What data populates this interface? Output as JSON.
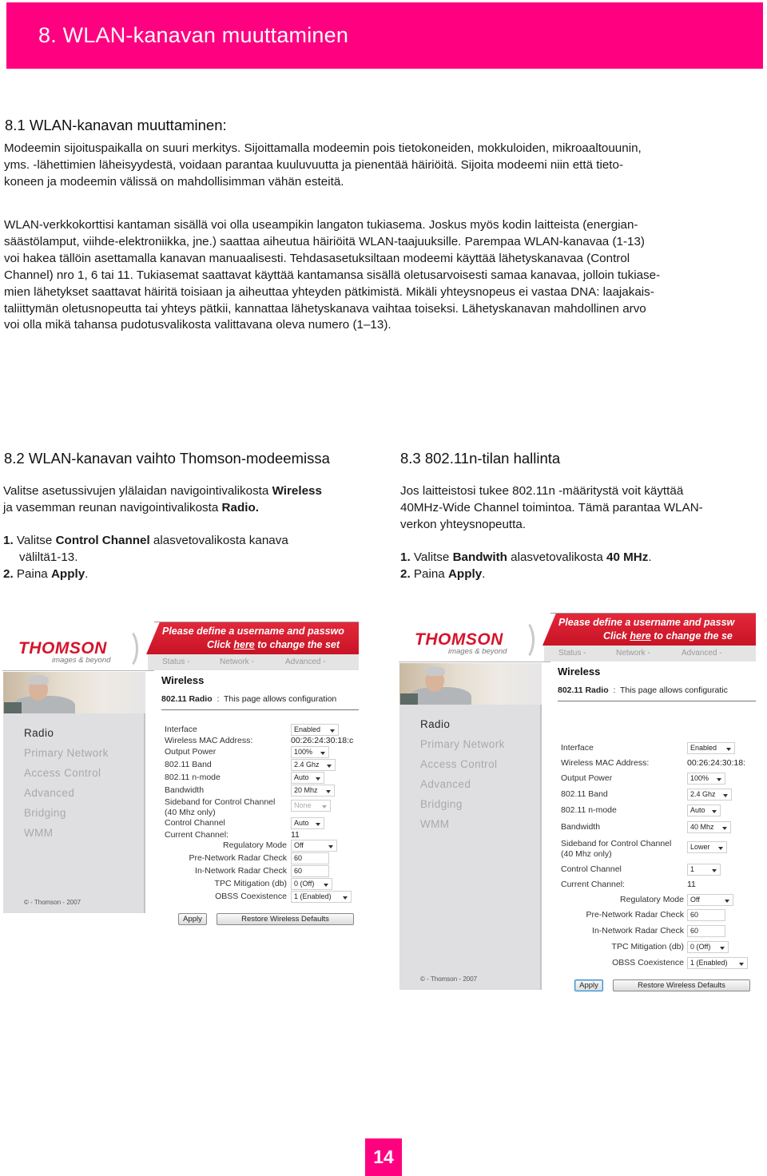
{
  "colors": {
    "accent": "#FF0080",
    "modem_red": "#D5142B"
  },
  "header": {
    "title": "8. WLAN-kanavan muuttaminen"
  },
  "section_8_1": {
    "heading": "8.1 WLAN-kanavan muuttaminen:",
    "paragraph1_lines": [
      "Modeemin sijoituspaikalla on suuri merkitys. Sijoittamalla modeemin pois tietokoneiden, mokkuloiden, mikroaaltouunin,",
      "yms. -lähettimien läheisyydestä, voidaan parantaa kuuluvuutta ja pienentää häiriöitä. Sijoita modeemi niin että tieto-",
      "koneen ja modeemin välissä on mahdollisimman vähän esteitä."
    ],
    "paragraph2_lines": [
      "WLAN-verkkokorttisi kantaman sisällä voi olla useampikin langaton tukiasema. Joskus myös kodin laitteista (energian-",
      "säästölamput, viihde-elektroniikka, jne.) saattaa aiheutua häiriöitä WLAN-taajuuksille. Parempaa WLAN-kanavaa (1-13)",
      "voi hakea tällöin asettamalla kanavan manuaalisesti. Tehdasasetuksiltaan modeemi käyttää lähetyskanavaa (Control",
      "Channel) nro 1, 6 tai 11. Tukiasemat saattavat käyttää kantamansa sisällä oletusarvoisesti samaa kanavaa, jolloin tukiase-",
      "mien lähetykset saattavat häiritä toisiaan ja aiheuttaa yhteyden pätkimistä. Mikäli yhteysnopeus ei vastaa DNA: laajakais-",
      "taliittymän oletusnopeutta tai yhteys pätkii, kannattaa lähetyskanava vaihtaa toiseksi. Lähetyskanavan mahdollinen arvo",
      "voi olla mikä tahansa pudotusvalikosta valittavana oleva numero (1–13)."
    ]
  },
  "section_8_2": {
    "heading": "8.2 WLAN-kanavan vaihto Thomson-modeemissa",
    "intro": {
      "l1_pre": "Valitse asetussivujen ylälaidan navigointivalikosta ",
      "l1_bold": "Wireless",
      "l2_pre": "ja vasemman reunan navigointivalikosta ",
      "l2_bold": "Radio."
    },
    "steps": [
      {
        "num": "1.",
        "pre": " Valitse ",
        "bold": "Control Channel",
        "post": " alasvetovalikosta kanava",
        "cont": "väliltä1-13."
      },
      {
        "num": "2.",
        "pre": " Paina ",
        "bold": "Apply",
        "post": "."
      }
    ]
  },
  "section_8_3": {
    "heading": "8.3 802.11n-tilan hallinta",
    "intro_lines": [
      "Jos laitteistosi tukee 802.11n -määritystä voit käyttää",
      "40MHz-Wide Channel toimintoa. Tämä parantaa WLAN-",
      "verkon yhteysnopeutta."
    ],
    "steps": [
      {
        "num": "1.",
        "pre": " Valitse ",
        "bold": "Bandwith",
        "mid": " alasvetovalikosta ",
        "bold2": "40 MHz",
        "post": "."
      },
      {
        "num": "2.",
        "pre": " Paina ",
        "bold": "Apply",
        "post": "."
      }
    ]
  },
  "screenshots": [
    {
      "logo": "THOMSON",
      "logo_sub": "images & beyond",
      "banner_line1": "Please define a username and passwo",
      "banner_line2_pre": "Click ",
      "banner_link": "here",
      "banner_line2_post": " to change the set",
      "nav": [
        "Status -",
        "Network -",
        "Advanced -"
      ],
      "page_title": "Wireless",
      "subtitle_bold": "802.11 Radio",
      "subtitle_rest": "  :  This page allows configuration",
      "sidebar": [
        "Radio",
        "Primary Network",
        "Access Control",
        "Advanced",
        "Bridging",
        "WMM"
      ],
      "copyright": "© - Thomson - 2007",
      "fields": {
        "interface": {
          "label": "Interface",
          "value": "Enabled"
        },
        "mac": {
          "label": "Wireless MAC Address:",
          "value": "00:26:24:30:18:c"
        },
        "output_power": {
          "label": "Output Power",
          "value": "100%"
        },
        "band": {
          "label": "802.11 Band",
          "value": "2.4 Ghz"
        },
        "nmode": {
          "label": "802.11 n-mode",
          "value": "Auto"
        },
        "bandwidth": {
          "label": "Bandwidth",
          "value": "20 Mhz"
        },
        "sideband": {
          "label1": "Sideband for Control Channel",
          "label2": "(40 Mhz only)",
          "value": "None"
        },
        "control_channel": {
          "label": "Control Channel",
          "value": "Auto"
        },
        "current_channel": {
          "label": "Current Channel:",
          "value": "11"
        },
        "regulatory": {
          "label": "Regulatory Mode",
          "value": "Off"
        },
        "pre_radar": {
          "label": "Pre-Network Radar Check",
          "value": "60"
        },
        "in_radar": {
          "label": "In-Network Radar Check",
          "value": "60"
        },
        "tpc": {
          "label": "TPC Mitigation (db)",
          "value": "0 (Off)"
        },
        "obss": {
          "label": "OBSS Coexistence",
          "value": "1 (Enabled)"
        }
      },
      "apply": "Apply",
      "restore": "Restore Wireless Defaults"
    },
    {
      "logo": "THOMSON",
      "logo_sub": "images & beyond",
      "banner_line1": "Please define a username and passw",
      "banner_line2_pre": "Click ",
      "banner_link": "here",
      "banner_line2_post": " to change the se",
      "nav": [
        "Status -",
        "Network -",
        "Advanced -"
      ],
      "page_title": "Wireless",
      "subtitle_bold": "802.11 Radio",
      "subtitle_rest": "  :  This page allows configuratic",
      "sidebar": [
        "Radio",
        "Primary Network",
        "Access Control",
        "Advanced",
        "Bridging",
        "WMM"
      ],
      "copyright": "© - Thomson - 2007",
      "fields": {
        "interface": {
          "label": "Interface",
          "value": "Enabled"
        },
        "mac": {
          "label": "Wireless MAC Address:",
          "value": "00:26:24:30:18:"
        },
        "output_power": {
          "label": "Output Power",
          "value": "100%"
        },
        "band": {
          "label": "802.11 Band",
          "value": "2.4 Ghz"
        },
        "nmode": {
          "label": "802.11 n-mode",
          "value": "Auto"
        },
        "bandwidth": {
          "label": "Bandwidth",
          "value": "40 Mhz"
        },
        "sideband": {
          "label1": "Sideband for Control Channel",
          "label2": "(40 Mhz only)",
          "value": "Lower"
        },
        "control_channel": {
          "label": "Control Channel",
          "value": "1"
        },
        "current_channel": {
          "label": "Current Channel:",
          "value": "11"
        },
        "regulatory": {
          "label": "Regulatory Mode",
          "value": "Off"
        },
        "pre_radar": {
          "label": "Pre-Network Radar Check",
          "value": "60"
        },
        "in_radar": {
          "label": "In-Network Radar Check",
          "value": "60"
        },
        "tpc": {
          "label": "TPC Mitigation (db)",
          "value": "0 (Off)"
        },
        "obss": {
          "label": "OBSS Coexistence",
          "value": "1 (Enabled)"
        }
      },
      "apply": "Apply",
      "restore": "Restore Wireless Defaults"
    }
  ],
  "page_number": "14"
}
